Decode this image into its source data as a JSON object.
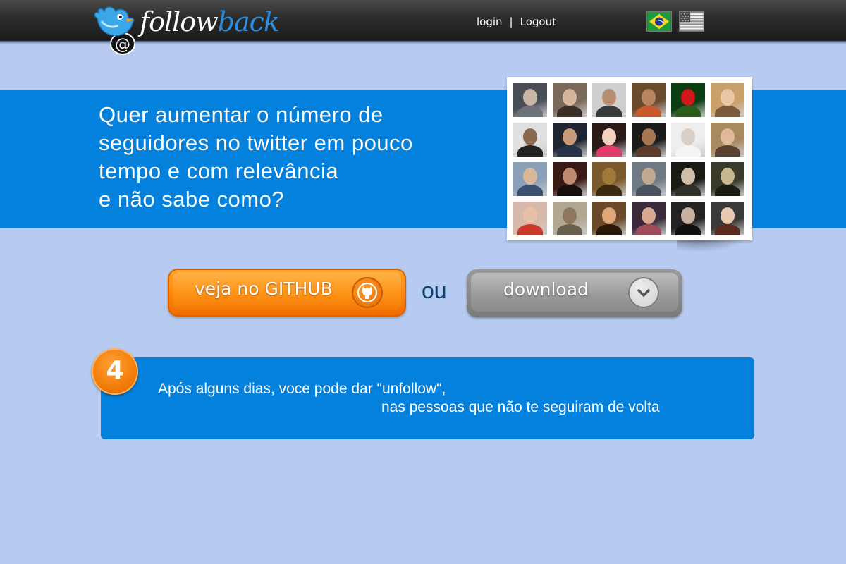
{
  "header": {
    "logo": {
      "word1": "follow",
      "word2": "back"
    },
    "nav": {
      "login": "login",
      "separator": "|",
      "logout": "Logout"
    },
    "languages": [
      {
        "name": "brazil-flag-icon",
        "label": "Português"
      },
      {
        "name": "usa-flag-icon",
        "label": "English"
      }
    ]
  },
  "hero": {
    "lines": [
      "Quer aumentar o número de",
      "seguidores no twitter em pouco",
      "tempo e com relevância",
      "e não sabe como?"
    ]
  },
  "actions": {
    "github_label": "veja no GITHUB",
    "or_label": "ou",
    "download_label": "download"
  },
  "step": {
    "number": "4",
    "line1": "Após alguns dias, voce pode dar \"unfollow\",",
    "line2": "nas pessoas que não te seguiram de volta"
  },
  "colors": {
    "page_bg": "#b6cbef",
    "accent_blue": "#0481dc",
    "orange": "#ff8a0a",
    "header_dark": "#2b2b2b"
  }
}
